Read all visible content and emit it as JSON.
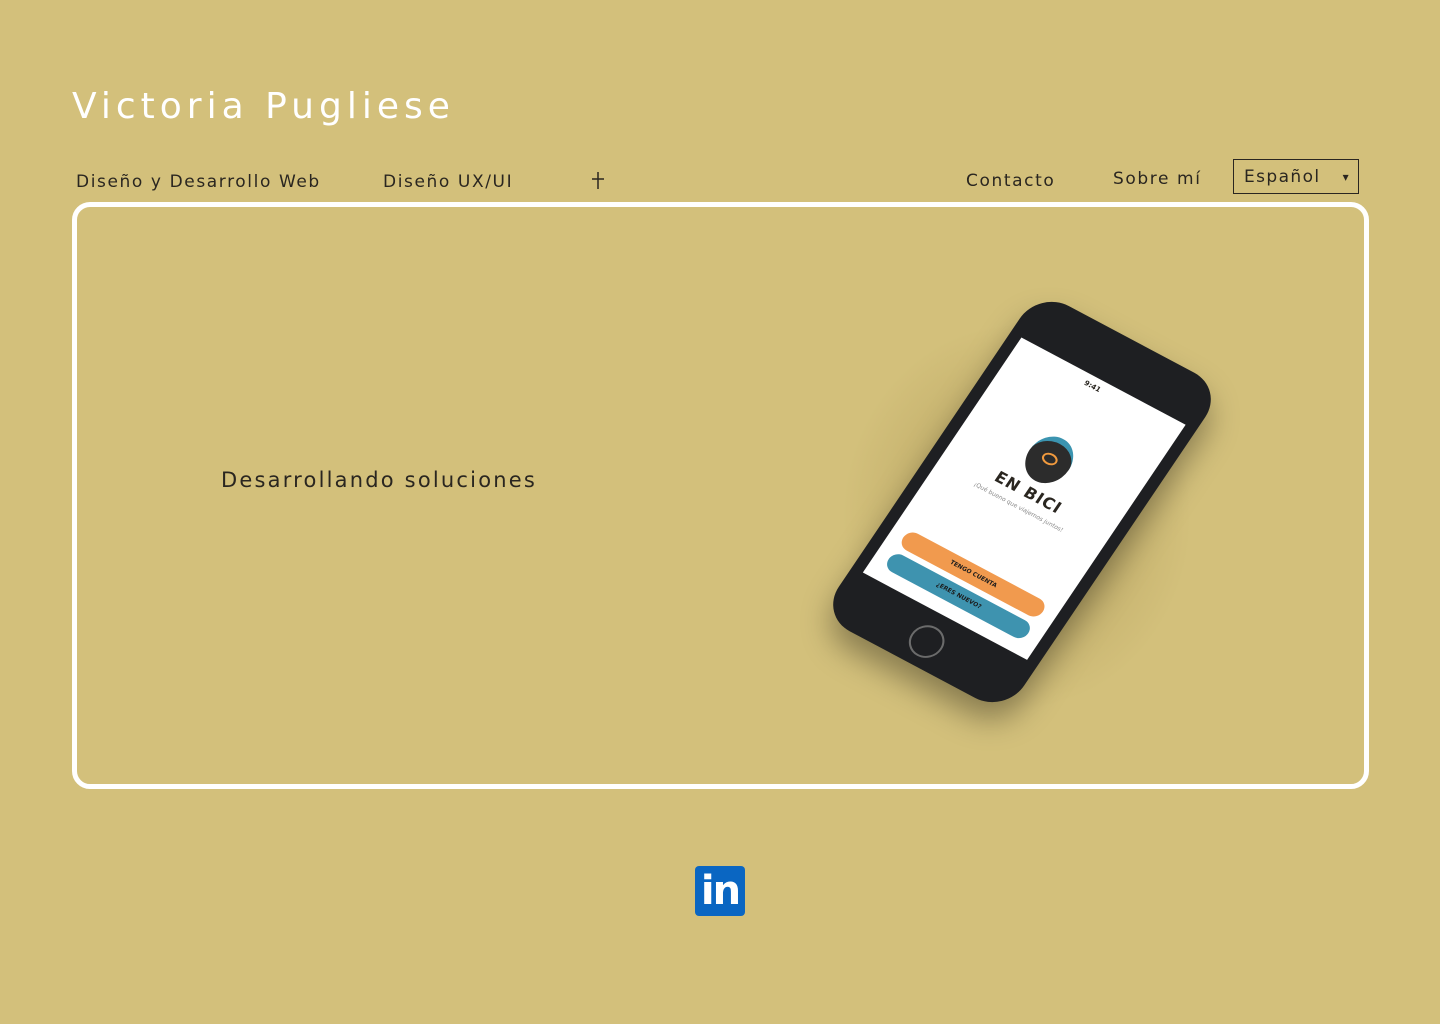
{
  "header": {
    "site_title": "Victoria Pugliese"
  },
  "nav": {
    "left_items": [
      {
        "label": "Diseño y Desarrollo Web"
      },
      {
        "label": "Diseño UX/UI"
      }
    ],
    "more_icon": "plus-icon",
    "right_items": [
      {
        "label": "Contacto"
      },
      {
        "label": "Sobre mí"
      }
    ],
    "language": {
      "selected": "Español",
      "caret": "▾"
    }
  },
  "hero": {
    "tagline": "Desarrollando soluciones",
    "phone_mockup": {
      "status_time": "9:41",
      "app_name": "EN BICI",
      "app_subtitle": "¡Qué bueno que viajemos juntos!",
      "primary_button": "TENGO CUENTA",
      "secondary_button": "¿ERES NUEVO?"
    }
  },
  "footer": {
    "social_icon": "linkedin-icon",
    "social_label": "in"
  },
  "colors": {
    "background": "#d3c07b",
    "frame": "#ffffff",
    "text": "#2a2620",
    "linkedin": "#0a66c2",
    "app_orange": "#f19a4e",
    "app_blue": "#3e93af"
  }
}
